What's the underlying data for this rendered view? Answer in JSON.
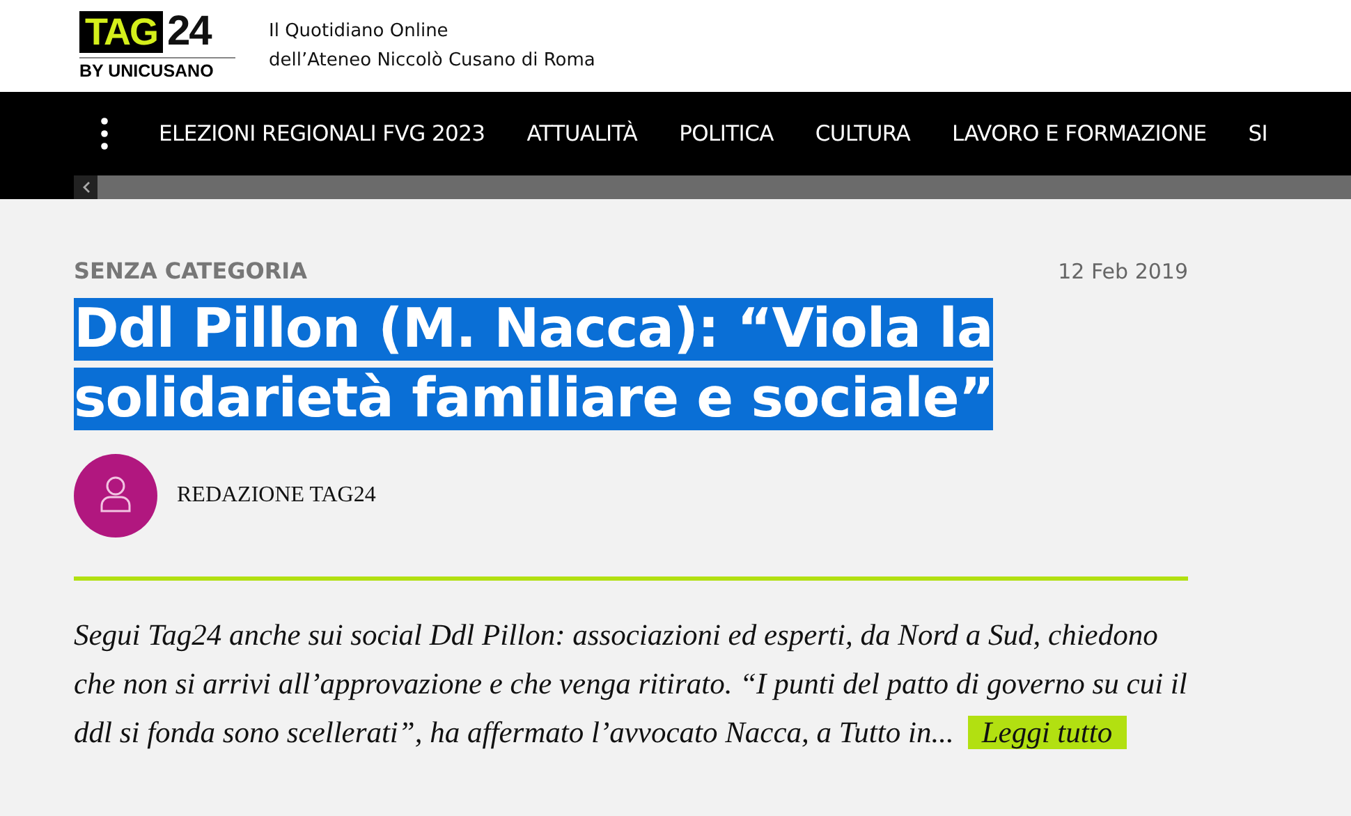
{
  "logo": {
    "brand": "TAG",
    "number": "24",
    "byline": "BY UNICUSANO"
  },
  "tagline": [
    "Il Quotidiano Online",
    "dell’Ateneo Niccolò Cusano di Roma"
  ],
  "nav": {
    "items": [
      {
        "label": "ELEZIONI REGIONALI FVG 2023"
      },
      {
        "label": "ATTUALITÀ"
      },
      {
        "label": "POLITICA"
      },
      {
        "label": "CULTURA"
      },
      {
        "label": "LAVORO E FORMAZIONE"
      },
      {
        "label": "SI"
      }
    ]
  },
  "article": {
    "category": "SENZA CATEGORIA",
    "date": "12 Feb 2019",
    "title": "Ddl Pillon (M. Nacca): “Viola la solidarietà familiare e sociale”",
    "title_selected": true,
    "author": "REDAZIONE TAG24",
    "excerpt": "Segui Tag24 anche sui social Ddl Pillon: associazioni ed esperti, da Nord a Sud, chiedono che non si arrivi all’approvazione e che venga ritirato. “I punti del patto di governo su cui il ddl si fonda sono scellerati”, ha affermato l’avvocato Nacca, a Tutto in...",
    "read_more": "Leggi tutto"
  }
}
